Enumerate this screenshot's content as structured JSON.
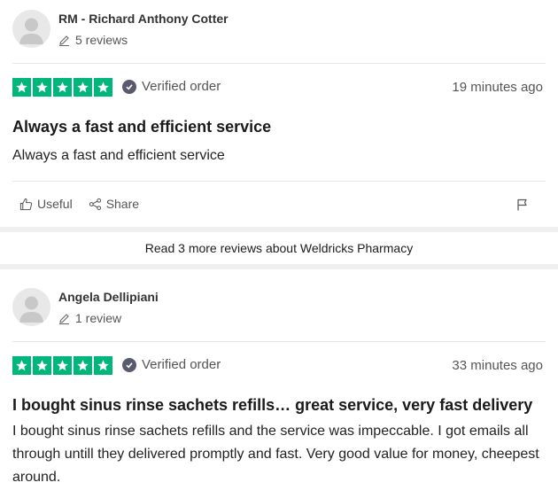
{
  "brand": {
    "star_green": "#00b67a"
  },
  "read_more": "Read 3 more reviews about Weldricks Pharmacy",
  "reviews": [
    {
      "reviewer_name": "RM - Richard Anthony Cotter",
      "review_count": "5 reviews",
      "rating": 5,
      "verified_label": "Verified order",
      "time": "19 minutes ago",
      "title": "Always a fast and efficient service",
      "body": "Always a fast and efficient service",
      "useful_label": "Useful",
      "share_label": "Share"
    },
    {
      "reviewer_name": "Angela Dellipiani",
      "review_count": "1 review",
      "rating": 5,
      "verified_label": "Verified order",
      "time": "33 minutes ago",
      "title": "I bought sinus rinse sachets refills… great service, very fast delivery",
      "body": "I bought sinus rinse sachets refills and the service was impeccable. I got emails all through untill they delivered promptly and fast. Very good value for money, cheepest around."
    }
  ],
  "icons": [
    "avatar-icon",
    "pencil-icon",
    "star-icon",
    "check-icon",
    "thumbs-up-icon",
    "share-icon",
    "flag-icon"
  ]
}
